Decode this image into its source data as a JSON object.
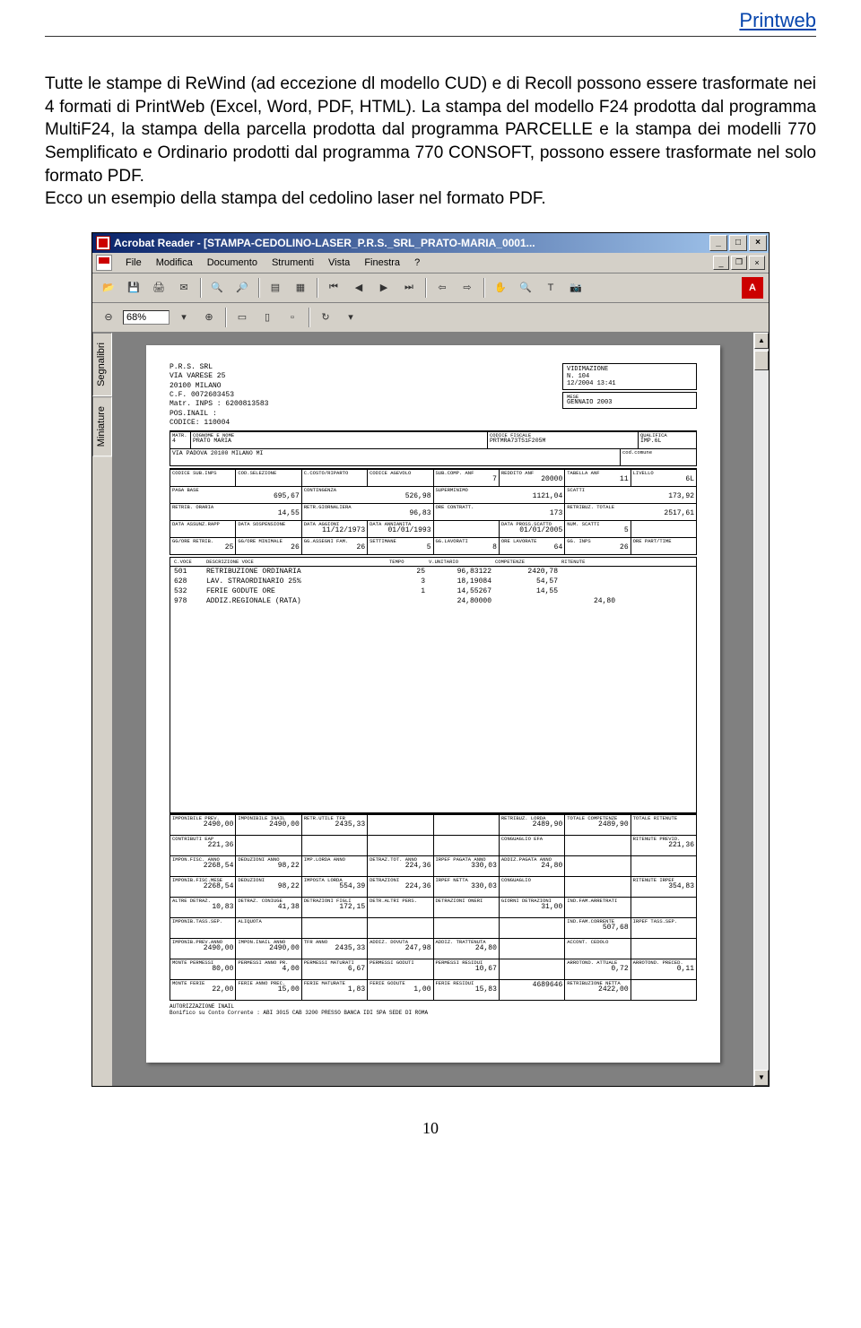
{
  "header_link": "Printweb",
  "paragraph": "Tutte le stampe di ReWind (ad eccezione dl modello CUD) e di Recoll possono essere trasformate nei 4 formati di PrintWeb (Excel, Word, PDF, HTML). La stampa del modello F24 prodotta dal programma MultiF24, la stampa della parcella prodotta dal programma PARCELLE e la stampa dei modelli 770 Semplificato e Ordinario prodotti dal programma 770 CONSOFT, possono essere trasformate nel solo formato PDF.",
  "paragraph2": "Ecco un esempio della stampa del cedolino laser nel formato PDF.",
  "pageNumber": "10",
  "acrobat": {
    "title": "Acrobat Reader - [STAMPA-CEDOLINO-LASER_P.R.S._SRL_PRATO-MARIA_0001...",
    "menus": [
      "File",
      "Modifica",
      "Documento",
      "Strumenti",
      "Vista",
      "Finestra",
      "?"
    ],
    "zoom": "68%",
    "tabs": [
      "Segnalibri",
      "Miniature"
    ]
  },
  "cedolino": {
    "azienda": {
      "nome": "P.R.S. SRL",
      "indirizzo": "VIA VARESE 25",
      "citta": "20100 MILANO",
      "cf": "C.F. 0072603453",
      "matr": "Matr. INPS : 6200813583",
      "posinail": "POS.INAIL :",
      "codice": "CODICE:   110004"
    },
    "vidimazione": {
      "label": "VIDIMAZIONE",
      "n": "N.    104",
      "data": "12/2004 13:41"
    },
    "mese": {
      "label": "MESE",
      "val": "GENNAIO     2003"
    },
    "dip": {
      "matr": "4",
      "nome": "PRATO          MARIA",
      "via": "VIA  PADOVA   20100    MILANO   MI",
      "cflabel": "CODICE FISCALE",
      "cf": "PRTMRA73T51F205M",
      "qual": "QUALIFICA",
      "qualv": "IMP.6L",
      "codcom": "cod.comune"
    },
    "row1": {
      "h": [
        "CODICE SUB.INPS",
        "COD.SELEZIONE",
        "C.COSTO/RIPARTO",
        "CODICE AGEVOLO",
        "SUB.COMP. ANF",
        "REDDITO ANF",
        "TABELLA ANF",
        "LIVELLO"
      ],
      "v": [
        "",
        "",
        "",
        "",
        "7",
        "20000",
        "11",
        "6L"
      ]
    },
    "row2": {
      "h": [
        "PAGA BASE",
        "CONTINGENZA",
        "SUPERMINIMO",
        "SCATTI"
      ],
      "v": [
        "695,67",
        "526,98",
        "1121,04",
        "173,92"
      ]
    },
    "row3": {
      "h": [
        "RETRIB. ORARIA",
        "RETR.GIORNALIERA",
        "ORE CONTRATT.",
        "RETRIBUZ. TOTALE"
      ],
      "v": [
        "14,55",
        "96,83",
        "173",
        "2517,61"
      ]
    },
    "row4": {
      "h": [
        "DATA ASSUNZ.RAPP",
        "DATA SOSPENSIONE",
        "DATA AGGIONI",
        "DATA ANNIANITA",
        "",
        "DATA PROSS.SCATTO",
        "NUM. SCATTI",
        ""
      ],
      "v": [
        "",
        "",
        "11/12/1973",
        "01/01/1993",
        "",
        "01/01/2005",
        "5",
        ""
      ]
    },
    "row5": {
      "h": [
        "GG/ORE RETRIB.",
        "GG/ORE MINIMALE",
        "GG.ASSEGNI FAM.",
        "SETTIMANE",
        "GG.LAVORATI",
        "ORE LAVORATE",
        "GG. INPS",
        "ORE PART/TIME"
      ],
      "v": [
        "25",
        "26",
        "26",
        "5",
        "8",
        "64",
        "26",
        ""
      ]
    },
    "voci_head": [
      "C.VOCE",
      "DESCRIZIONE VOCE",
      "TEMPO",
      "V.UNITARIO",
      "COMPETENZE",
      "RITENUTE"
    ],
    "voci": [
      {
        "c": "501",
        "d": "RETRIBUZIONE ORDINARIA",
        "t": "25",
        "u": "96,83122",
        "comp": "2420,78",
        "rit": ""
      },
      {
        "c": "628",
        "d": "LAV. STRAORDINARIO 25%",
        "t": "3",
        "u": "18,19084",
        "comp": "54,57",
        "rit": ""
      },
      {
        "c": "532",
        "d": "FERIE GODUTE ORE",
        "t": "1",
        "u": "14,55267",
        "comp": "14,55",
        "rit": ""
      },
      {
        "c": "978",
        "d": "ADDIZ.REGIONALE (RATA)",
        "t": "",
        "u": "24,80000",
        "comp": "",
        "rit": "24,80"
      }
    ],
    "tot": [
      {
        "h": [
          "IMPONIBILE PREV.",
          "IMPONIBILE INAIL",
          "RETR.UTILE TFR",
          "",
          "",
          "RETRIBUZ. LORDA",
          "TOTALE COMPETENZE",
          "TOTALE RITENUTE"
        ],
        "v": [
          "2490,00",
          "2490,00",
          "2435,33",
          "",
          "",
          "2489,90",
          "2489,90",
          ""
        ]
      },
      {
        "h": [
          "CONTRIBUTI EAP",
          "",
          "",
          "",
          "",
          "CONGUAGLIO EFA",
          "",
          "RITENUTE PREVID."
        ],
        "v": [
          "221,36",
          "",
          "",
          "",
          "",
          "",
          "",
          "221,36"
        ]
      },
      {
        "h": [
          "IMPON.FISC. ANNO",
          "DEDUZIONI ANNO",
          "IMP.LORDA ANNO",
          "DETRAZ.TOT. ANNO",
          "IRPEF PAGATA ANNO",
          "ADDIZ.PAGATA ANNO",
          "",
          ""
        ],
        "v": [
          "2268,54",
          "98,22",
          "",
          "224,36",
          "330,03",
          "24,80",
          "",
          ""
        ]
      },
      {
        "h": [
          "IMPONIB.FISC.MESE",
          "DEDUZIONI",
          "IMPOSTA LORDA",
          "DETRAZIONI",
          "IRPEF NETTA",
          "CONGUAGLIO",
          "",
          "RITENUTE IRPEF"
        ],
        "v": [
          "2268,54",
          "98,22",
          "554,39",
          "224,36",
          "330,03",
          "",
          "",
          "354,83"
        ]
      },
      {
        "h": [
          "ALTRE DETRAZ.",
          "DETRAZ. CONIUGE",
          "DETRAZIONI FIGLI",
          "DETR.ALTRI PERS.",
          "DETRAZIONI ONERI",
          "GIORNI DETRAZIONI",
          "IND.FAM.ARRETRATI",
          ""
        ],
        "v": [
          "10,83",
          "41,38",
          "172,15",
          "",
          "",
          "31,00",
          "",
          ""
        ]
      },
      {
        "h": [
          "IMPONIB.TASS.SEP.",
          "ALIQUOTA",
          "",
          "",
          "",
          "",
          "IND.FAM.CORRENTE",
          "IRPEF TASS.SEP."
        ],
        "v": [
          "",
          "",
          "",
          "",
          "",
          "",
          "507,68",
          ""
        ]
      },
      {
        "h": [
          "IMPONIB.PREV.ANNO",
          "IMPON.INAIL ANNO",
          "TFR ANNO",
          "ADDIZ. DOVUTA",
          "ADDIZ. TRATTENUTA",
          "",
          "ACCONT. CEDOLO",
          ""
        ],
        "v": [
          "2490,00",
          "2490,00",
          "2435,33",
          "247,98",
          "24,80",
          "",
          "",
          ""
        ]
      },
      {
        "h": [
          "MONTE PERMESSI",
          "PERMESSI ANNO PR.",
          "PERMESSI MATURATI",
          "PERMESSI GODUTI",
          "PERMESSI RESIDUI",
          "",
          "ARROTOND. ATTUALE",
          "ARROTOND. PRECED."
        ],
        "v": [
          "80,00",
          "4,00",
          "6,67",
          "",
          "10,67",
          "",
          "0,72",
          "0,11"
        ]
      },
      {
        "h": [
          "MONTE FERIE",
          "FERIE ANNO PREC.",
          "FERIE MATURATE",
          "FERIE GODUTE",
          "FERIE RESIDUI",
          "",
          "RETRIBUZIONE NETTA",
          ""
        ],
        "v": [
          "22,00",
          "15,00",
          "1,83",
          "1,00",
          "15,83",
          "4689646",
          "2422,00",
          ""
        ]
      }
    ],
    "footer": "AUTORIZZAZIONE INAIL\nBonifico su Conto Corrente :   ABI 3015 CAB 3200  PRESSO BANCA IDI SPA  SEDE DI ROMA"
  }
}
